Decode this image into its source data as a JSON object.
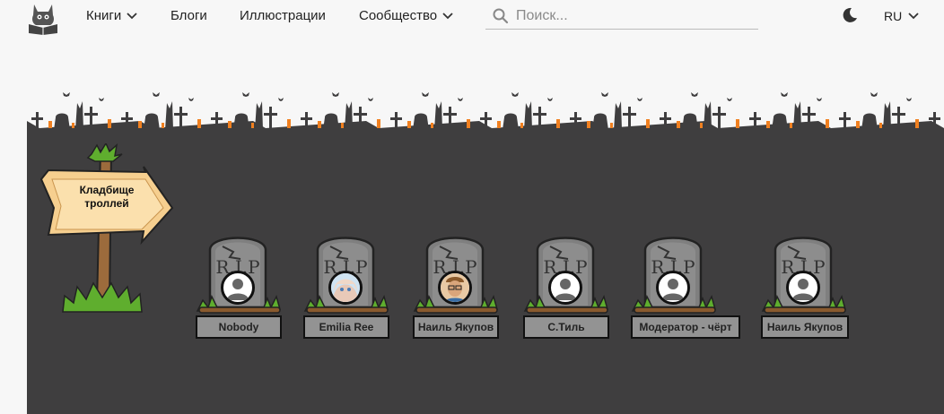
{
  "nav": {
    "books": "Книги",
    "blogs": "Блоги",
    "illustrations": "Иллюстрации",
    "community": "Сообщество"
  },
  "search": {
    "placeholder": "Поиск..."
  },
  "lang": {
    "current": "RU"
  },
  "sign": {
    "line1": "Кладбище",
    "line2": "троллей"
  },
  "graves": [
    {
      "name": "Nobody",
      "avatar": "default-avatar-icon"
    },
    {
      "name": "Emilia Ree",
      "avatar": "anime-girl-avatar"
    },
    {
      "name": "Наиль Якупов",
      "avatar": "photo-avatar"
    },
    {
      "name": "С.Тиль",
      "avatar": "default-avatar-icon"
    },
    {
      "name": "Модератор - чёрт",
      "avatar": "default-avatar-icon"
    },
    {
      "name": "Наиль Якупов",
      "avatar": "default-avatar-icon"
    }
  ],
  "colors": {
    "ground": "#3f3e3f",
    "stone": "#7f7f7f",
    "grass": "#5fae2e",
    "plate": "#939393",
    "candle": "#f08020"
  },
  "tombstone_text": "R.I.P"
}
